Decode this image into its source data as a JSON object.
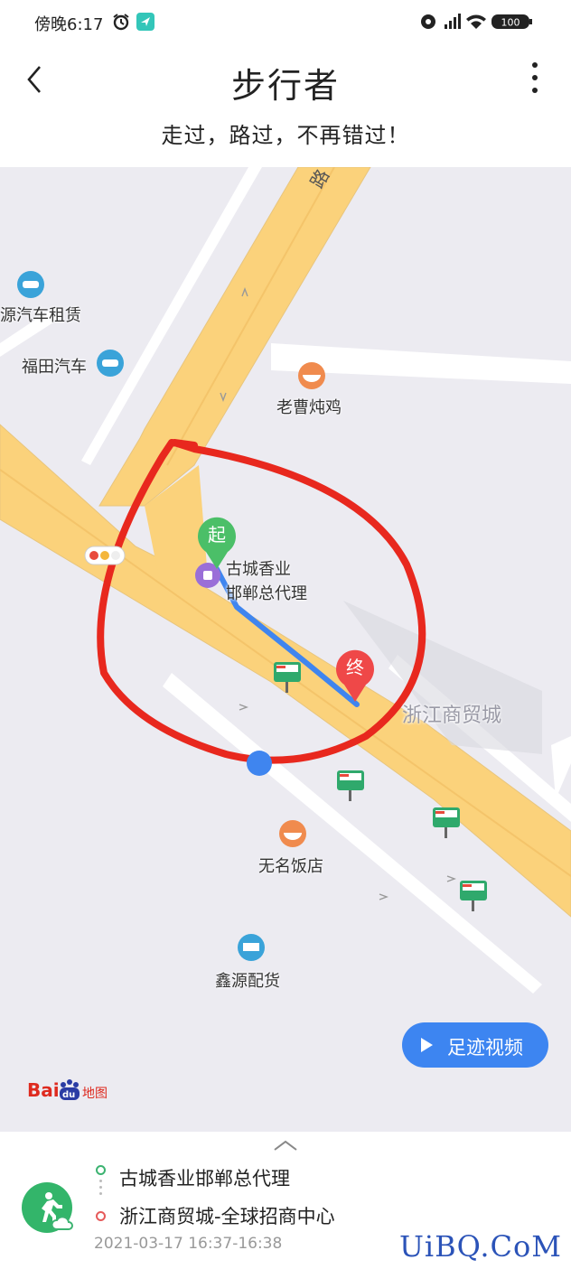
{
  "status_bar": {
    "time": "傍晚6:17",
    "battery": "100"
  },
  "header": {
    "title": "步行者",
    "subtitle": "走过，路过，不再错过！"
  },
  "map": {
    "road_label": "路",
    "pois": [
      "源汽车租赁",
      "福田汽车",
      "老曹炖鸡",
      "古城香业",
      "邯郸总代理",
      "浙江商贸城",
      "无名饭店",
      "鑫源配货"
    ],
    "start_marker": "起",
    "end_marker": "终",
    "video_button": "足迹视频",
    "logo_brand": "Bai",
    "logo_du": "du",
    "logo_suffix": "地图"
  },
  "record": {
    "from": "古城香业邯郸总代理",
    "to": "浙江商贸城-全球招商中心",
    "time_range": "2021-03-17 16:37-16:38"
  },
  "watermark": "UiBQ.CoM",
  "colors": {
    "road": "#fbd27b",
    "route": "#3f85ef",
    "annotation": "#e8281e",
    "start": "#4bbf68",
    "end": "#ef4848",
    "button": "#3d85f1"
  }
}
